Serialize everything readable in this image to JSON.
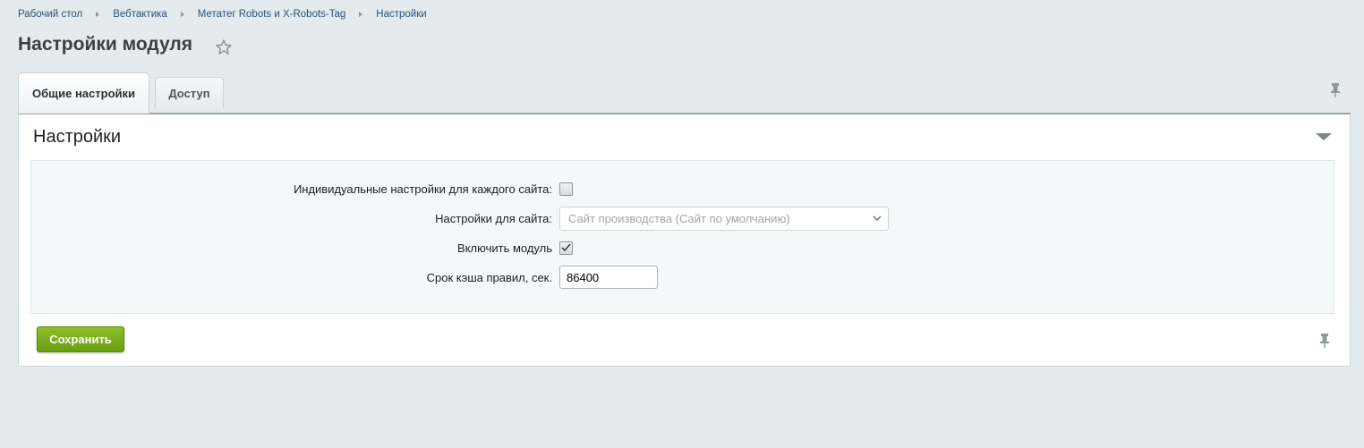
{
  "breadcrumb": [
    "Рабочий стол",
    "Вебтактика",
    "Метатег Robots и X-Robots-Tag",
    "Настройки"
  ],
  "page_title": "Настройки модуля",
  "tabs": [
    {
      "label": "Общие настройки",
      "active": true
    },
    {
      "label": "Доступ",
      "active": false
    }
  ],
  "section": {
    "title": "Настройки",
    "fields": {
      "individual": {
        "label": "Индивидуальные настройки для каждого сайта:",
        "checked": false
      },
      "site": {
        "label": "Настройки для сайта:",
        "value": "Сайт производства (Сайт по умолчанию)"
      },
      "enable": {
        "label": "Включить модуль",
        "checked": true
      },
      "cache": {
        "label": "Срок кэша правил, сек.",
        "value": "86400"
      }
    }
  },
  "save_label": "Сохранить",
  "colors": {
    "save": "#7ab01d",
    "link": "#2b5077",
    "bg": "#e4ebee"
  }
}
